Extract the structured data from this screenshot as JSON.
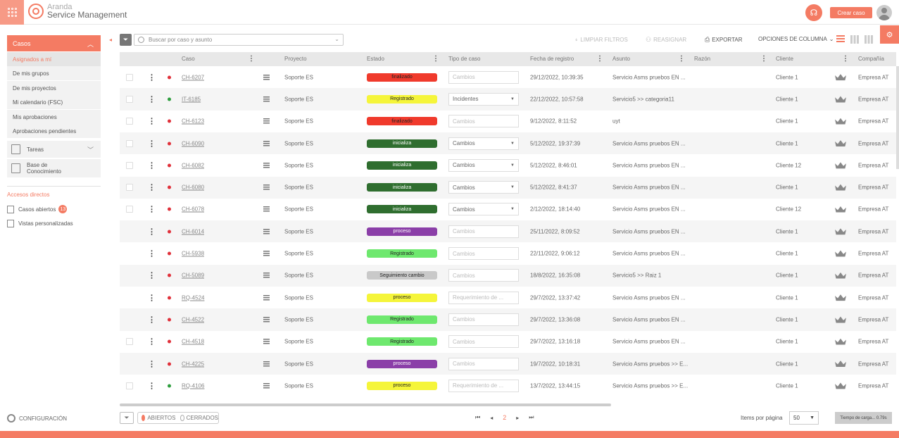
{
  "app": {
    "brand_top": "Aranda",
    "brand_bottom": "Service Management",
    "create_label": "Crear caso"
  },
  "sidebar": {
    "casos_label": "Casos",
    "sub_items": [
      "Asignados a mí",
      "De mis grupos",
      "De mis proyectos",
      "Mi calendario (FSC)",
      "Mis aprobaciones",
      "Aprobaciones pendientes"
    ],
    "tareas_label": "Tareas",
    "base_label_1": "Base de",
    "base_label_2": "Conocimiento",
    "accesos_label": "Accesos directos",
    "casos_abiertos_label": "Casos abiertos",
    "casos_abiertos_count": "13",
    "vistas_label": "Vistas personalizadas",
    "config_label": "CONFIGURACIÓN"
  },
  "toolbar": {
    "search_placeholder": "Buscar por caso y asunto",
    "clear_filters": "LIMPIAR FILTROS",
    "reassign": "REASIGNAR",
    "export": "EXPORTAR",
    "column_options": "OPCIONES DE COLUMNA"
  },
  "table": {
    "headers": {
      "caso": "Caso",
      "proyecto": "Proyecto",
      "estado": "Estado",
      "tipo": "Tipo de caso",
      "fecha": "Fecha de registro",
      "asunto": "Asunto",
      "razon": "Razón",
      "cliente": "Cliente",
      "compania": "Compañía"
    },
    "rows": [
      {
        "check": true,
        "dot": "#e0303a",
        "id": "CH-6207",
        "proyecto": "Soporte ES",
        "estado": "finalizado",
        "estado_color": "#f03a2c",
        "estado_text_color": "#222",
        "tipo": "Cambios",
        "tipo_dim": true,
        "fecha": "29/12/2022, 10:39:35",
        "asunto": "Servicio Asms pruebos EN ...",
        "cliente": "Cliente 1",
        "compania": "Empresa AT"
      },
      {
        "check": true,
        "dot": "#2e9e3e",
        "id": "IT-6185",
        "proyecto": "Soporte ES",
        "estado": "Registrado",
        "estado_color": "#f5f53a",
        "estado_text_color": "#222",
        "tipo": "Incidentes",
        "tipo_dim": false,
        "fecha": "22/12/2022, 10:57:58",
        "asunto": "Servicio5 >> categoria11",
        "cliente": "Cliente 1",
        "compania": "Empresa AT"
      },
      {
        "check": true,
        "dot": "#e0303a",
        "id": "CH-6123",
        "proyecto": "Soporte ES",
        "estado": "finalizado",
        "estado_color": "#f03a2c",
        "estado_text_color": "#222",
        "tipo": "Cambios",
        "tipo_dim": true,
        "fecha": "9/12/2022, 8:11:52",
        "asunto": "uyt",
        "cliente": "Cliente 1",
        "compania": "Empresa AT"
      },
      {
        "check": true,
        "dot": "#e0303a",
        "id": "CH-6090",
        "proyecto": "Soporte ES",
        "estado": "inicializa",
        "estado_color": "#2f6e2f",
        "estado_text_color": "#fff",
        "tipo": "Cambios",
        "tipo_dim": false,
        "fecha": "5/12/2022, 19:37:39",
        "asunto": "Servicio Asms pruebos EN ...",
        "cliente": "Cliente 1",
        "compania": "Empresa AT"
      },
      {
        "check": true,
        "dot": "#e0303a",
        "id": "CH-6082",
        "proyecto": "Soporte ES",
        "estado": "inicializa",
        "estado_color": "#2f6e2f",
        "estado_text_color": "#fff",
        "tipo": "Cambios",
        "tipo_dim": false,
        "fecha": "5/12/2022, 8:46:01",
        "asunto": "Servicio Asms pruebos EN ...",
        "cliente": "Cliente 12",
        "compania": "Empresa AT"
      },
      {
        "check": true,
        "dot": "#e0303a",
        "id": "CH-6080",
        "proyecto": "Soporte ES",
        "estado": "inicializa",
        "estado_color": "#2f6e2f",
        "estado_text_color": "#fff",
        "tipo": "Cambios",
        "tipo_dim": false,
        "fecha": "5/12/2022, 8:41:37",
        "asunto": "Servicio Asms pruebos EN ...",
        "cliente": "Cliente 1",
        "compania": "Empresa AT"
      },
      {
        "check": true,
        "dot": "#e0303a",
        "id": "CH-6078",
        "proyecto": "Soporte ES",
        "estado": "inicializa",
        "estado_color": "#2f6e2f",
        "estado_text_color": "#fff",
        "tipo": "Cambios",
        "tipo_dim": false,
        "fecha": "2/12/2022, 18:14:40",
        "asunto": "Servicio Asms pruebos EN ...",
        "cliente": "Cliente 12",
        "compania": "Empresa AT"
      },
      {
        "check": false,
        "dot": "#e0303a",
        "id": "CH-6014",
        "proyecto": "Soporte ES",
        "estado": "proceso",
        "estado_color": "#8b3fa8",
        "estado_text_color": "#fff",
        "tipo": "Cambios",
        "tipo_dim": true,
        "fecha": "25/11/2022, 8:09:52",
        "asunto": "Servicio Asms pruebos EN ...",
        "cliente": "Cliente 1",
        "compania": "Empresa AT"
      },
      {
        "check": false,
        "dot": "#e0303a",
        "id": "CH-5938",
        "proyecto": "Soporte ES",
        "estado": "Registrado",
        "estado_color": "#6ee86e",
        "estado_text_color": "#222",
        "tipo": "Cambios",
        "tipo_dim": true,
        "fecha": "22/11/2022, 9:06:12",
        "asunto": "Servicio Asms pruebos EN ...",
        "cliente": "Cliente 1",
        "compania": "Empresa AT"
      },
      {
        "check": false,
        "dot": "#e0303a",
        "id": "CH-5089",
        "proyecto": "Soporte ES",
        "estado": "Seguimiento cambio",
        "estado_color": "#c9c9c9",
        "estado_text_color": "#222",
        "tipo": "Cambios",
        "tipo_dim": true,
        "fecha": "18/8/2022, 16:35:08",
        "asunto": "Servicio5 >> Raiz 1",
        "cliente": "Cliente 1",
        "compania": "Empresa AT"
      },
      {
        "check": false,
        "dot": "#e0303a",
        "id": "RQ-4524",
        "proyecto": "Soporte ES",
        "estado": "proceso",
        "estado_color": "#f5f53a",
        "estado_text_color": "#222",
        "tipo": "Requerimiento de ...",
        "tipo_dim": true,
        "fecha": "29/7/2022, 13:37:42",
        "asunto": "Servicio Asms pruebos EN ...",
        "cliente": "Cliente 1",
        "compania": "Empresa AT"
      },
      {
        "check": false,
        "dot": "#e0303a",
        "id": "CH-4522",
        "proyecto": "Soporte ES",
        "estado": "Registrado",
        "estado_color": "#6ee86e",
        "estado_text_color": "#222",
        "tipo": "Cambios",
        "tipo_dim": true,
        "fecha": "29/7/2022, 13:36:08",
        "asunto": "Servicio Asms pruebos EN ...",
        "cliente": "Cliente 1",
        "compania": "Empresa AT"
      },
      {
        "check": true,
        "dot": "#e0303a",
        "id": "CH-4518",
        "proyecto": "Soporte ES",
        "estado": "Registrado",
        "estado_color": "#6ee86e",
        "estado_text_color": "#222",
        "tipo": "Cambios",
        "tipo_dim": true,
        "fecha": "29/7/2022, 13:16:18",
        "asunto": "Servicio Asms pruebos EN ...",
        "cliente": "Cliente 1",
        "compania": "Empresa AT"
      },
      {
        "check": false,
        "dot": "#e0303a",
        "id": "CH-4225",
        "proyecto": "Soporte ES",
        "estado": "proceso",
        "estado_color": "#8b3fa8",
        "estado_text_color": "#fff",
        "tipo": "Cambios",
        "tipo_dim": true,
        "fecha": "19/7/2022, 10:18:31",
        "asunto": "Servicio Asms pruebos >> E...",
        "cliente": "Cliente 1",
        "compania": "Empresa AT"
      },
      {
        "check": true,
        "dot": "#2e9e3e",
        "id": "RQ-4106",
        "proyecto": "Soporte ES",
        "estado": "proceso",
        "estado_color": "#f5f53a",
        "estado_text_color": "#222",
        "tipo": "Requerimiento de ...",
        "tipo_dim": true,
        "fecha": "13/7/2022, 13:44:15",
        "asunto": "Servicio Asms pruebos >> E...",
        "cliente": "Cliente 1",
        "compania": "Empresa AT"
      }
    ]
  },
  "footer": {
    "abiertos": "ABIERTOS",
    "cerrados": "CERRADOS",
    "current_page": "2",
    "items_per_page_label": "Items por página",
    "items_per_page": "50",
    "load_time": "Tiempo de carga... 0.79s"
  },
  "colors": {
    "accent": "#f47b63"
  }
}
